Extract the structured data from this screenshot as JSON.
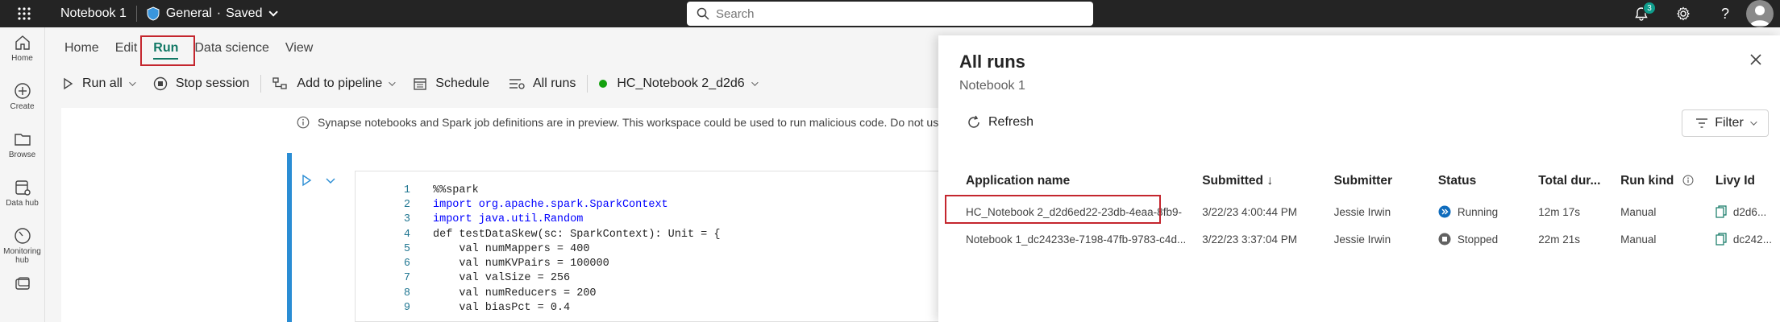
{
  "topbar": {
    "notebook_title": "Notebook 1",
    "workspace": "General",
    "dot": "·",
    "saved": "Saved",
    "search_placeholder": "Search",
    "notification_count": "3",
    "help_symbol": "?"
  },
  "nav": {
    "items": [
      {
        "label": "Home"
      },
      {
        "label": "Create"
      },
      {
        "label": "Browse"
      },
      {
        "label": "Data hub"
      },
      {
        "label": "Monitoring hub"
      }
    ]
  },
  "menu_tabs": [
    "Home",
    "Edit",
    "Run",
    "Data science",
    "View"
  ],
  "toolbar": {
    "run_all": "Run all",
    "stop_session": "Stop session",
    "add_to_pipeline": "Add to pipeline",
    "schedule": "Schedule",
    "all_runs": "All runs",
    "session_name": "HC_Notebook 2_d2d6"
  },
  "notice": "Synapse notebooks and Spark job definitions are in preview. This workspace could be used to run malicious code. Do not use this work",
  "code": {
    "line_numbers": [
      "1",
      "2",
      "3",
      "4",
      "5",
      "6",
      "7",
      "8",
      "9"
    ],
    "lines": [
      "%%spark",
      "import org.apache.spark.SparkContext",
      "import java.util.Random",
      "def testDataSkew(sc: SparkContext): Unit = {",
      "    val numMappers = 400",
      "    val numKVPairs = 100000",
      "    val valSize = 256",
      "    val numReducers = 200",
      "    val biasPct = 0.4"
    ]
  },
  "panel": {
    "title": "All runs",
    "subtitle": "Notebook 1",
    "refresh": "Refresh",
    "filter": "Filter",
    "columns": [
      "Application name",
      "Submitted",
      "Submitter",
      "Status",
      "Total dur...",
      "Run kind",
      "Livy Id"
    ],
    "sort_arrow": "↓",
    "rows": [
      {
        "app": "HC_Notebook 2_d2d6ed22-23db-4eaa-8fb9-",
        "submitted": "3/22/23 4:00:44 PM",
        "submitter": "Jessie Irwin",
        "status": "Running",
        "duration": "12m 17s",
        "kind": "Manual",
        "livy": "d2d6..."
      },
      {
        "app": "Notebook 1_dc24233e-7198-47fb-9783-c4d...",
        "submitted": "3/22/23 3:37:04 PM",
        "submitter": "Jessie Irwin",
        "status": "Stopped",
        "duration": "22m 21s",
        "kind": "Manual",
        "livy": "dc242..."
      }
    ]
  },
  "colors": {
    "accent": "#117865",
    "highlight_box": "#c4262e",
    "running": "#0f6cbd",
    "cell_bar": "#2a8dd4"
  }
}
